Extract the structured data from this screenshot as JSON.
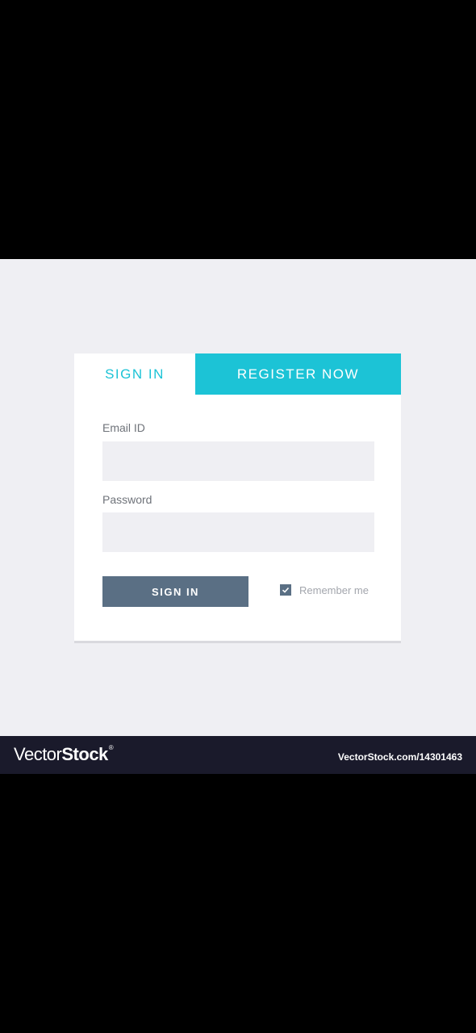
{
  "tabs": {
    "sign_in": "SIGN IN",
    "register": "REGISTER NOW"
  },
  "form": {
    "email_label": "Email ID",
    "email_value": "",
    "password_label": "Password",
    "password_value": "",
    "submit_label": "SIGN IN",
    "remember_label": "Remember me",
    "remember_checked": true
  },
  "watermark": {
    "logo_light": "Vector",
    "logo_bold": "Stock",
    "logo_mark": "®",
    "url": "VectorStock.com/14301463"
  },
  "colors": {
    "accent": "#1cc3d6",
    "button": "#5a6f84",
    "background": "#efeff3",
    "footer": "#1a1a2b"
  },
  "icons": {
    "checkbox": "check-icon"
  }
}
